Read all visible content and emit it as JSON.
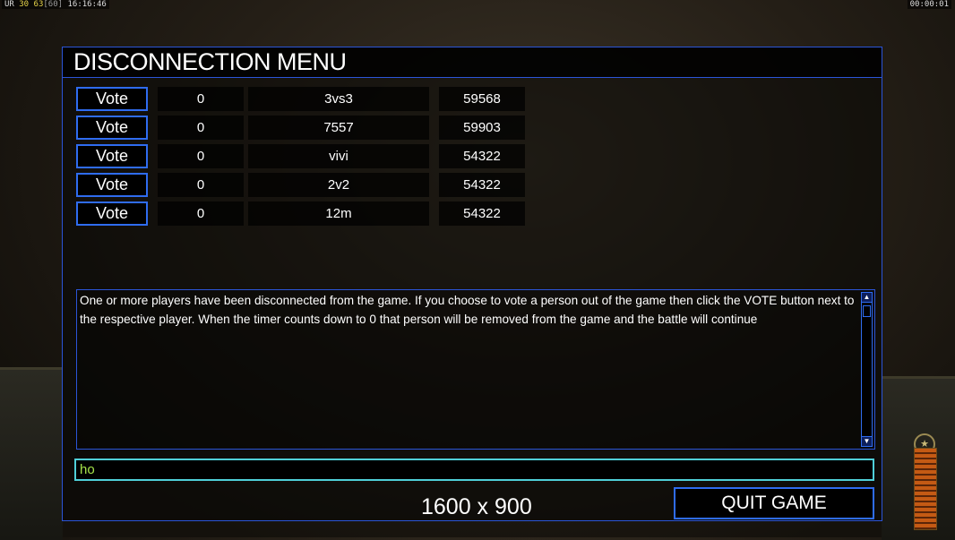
{
  "hud": {
    "left_prefix": "UR",
    "left_a": "30",
    "left_b": "63",
    "left_c": "[60]",
    "left_time": "16:16:46",
    "right_time": "00:00:01"
  },
  "panel": {
    "title": "DISCONNECTION MENU"
  },
  "players": [
    {
      "vote_label": "Vote",
      "timer": "0",
      "name": "3vs3",
      "ping": "59568"
    },
    {
      "vote_label": "Vote",
      "timer": "0",
      "name": "7557",
      "ping": "59903"
    },
    {
      "vote_label": "Vote",
      "timer": "0",
      "name": "vivi",
      "ping": "54322"
    },
    {
      "vote_label": "Vote",
      "timer": "0",
      "name": "2v2",
      "ping": "54322"
    },
    {
      "vote_label": "Vote",
      "timer": "0",
      "name": "12m",
      "ping": "54322"
    }
  ],
  "message": {
    "text": "One or more players have been disconnected from the game. If you choose to vote a person out of the game then click the VOTE button next to the respective player. When the timer counts down to 0 that person will be removed from the game and the battle will continue"
  },
  "chat": {
    "value": "ho"
  },
  "resolution_text": "1600 x 900",
  "quit_label": "QUIT GAME",
  "colors": {
    "border_blue": "#2b55d8",
    "button_blue": "#2f6cf0",
    "chat_border": "#4fcfd8",
    "chat_text": "#a6e34a"
  }
}
